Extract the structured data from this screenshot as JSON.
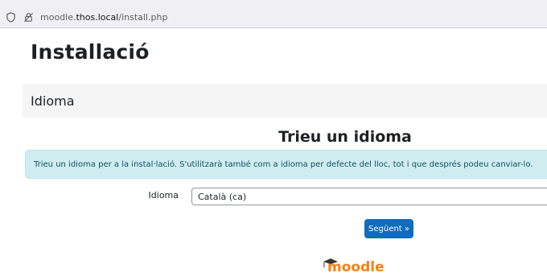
{
  "browser": {
    "url_prefix": "moodle.",
    "url_host": "thos.local",
    "url_path": "/install.php"
  },
  "page": {
    "title": "Installació",
    "section_header": "Idioma",
    "heading": "Trieu un idioma",
    "info_text": "Trieu un idioma per a la instal·lació. S'utilitzarà també com a idioma per defecte del lloc, tot i que després podeu canviar-lo.",
    "language_label": "Idioma",
    "language_value": "Català (ca)",
    "next_label": "Següent »",
    "logo_text": "moodle"
  },
  "colors": {
    "primary": "#0f6cbf",
    "logo_orange": "#f98012",
    "info_bg": "#d1ecf1"
  }
}
